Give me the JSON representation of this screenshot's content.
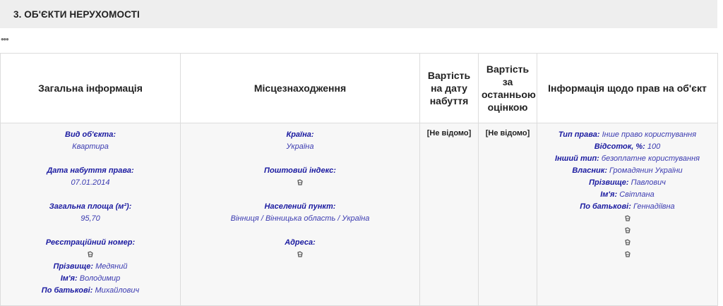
{
  "section": {
    "title": "3.   ОБ'ЄКТИ НЕРУХОМОСТІ"
  },
  "more": "•••",
  "headers": {
    "general": "Загальна інформація",
    "location": "Місцезнаходження",
    "cost_acq": "Вартість на дату набуття",
    "cost_eval": "Вартість за останньою оцінкою",
    "rights": "Інформація щодо прав на об'єкт"
  },
  "general": {
    "type_label": "Вид об'єкта:",
    "type_value": "Квартира",
    "date_label": "Дата набуття права:",
    "date_value": "07.01.2014",
    "area_label": "Загальна площа (м²):",
    "area_value": "95,70",
    "reg_label": "Реєстраційний номер:",
    "surname_label": "Прізвище:",
    "surname_value": "Медяний",
    "name_label": "Ім'я:",
    "name_value": "Володимир",
    "patronymic_label": "По батькові:",
    "patronymic_value": "Михайлович"
  },
  "location": {
    "country_label": "Країна:",
    "country_value": "Україна",
    "postal_label": "Поштовий індекс:",
    "settlement_label": "Населений пункт:",
    "settlement_value": "Вінниця / Вінницька область / Україна",
    "address_label": "Адреса:"
  },
  "cost_acq_value": "[Не відомо]",
  "cost_eval_value": "[Не відомо]",
  "rights": {
    "right_type_label": "Тип права:",
    "right_type_value": "Інше право користування",
    "percent_label": "Відсоток, %:",
    "percent_value": "100",
    "other_type_label": "Інший тип:",
    "other_type_value": "безоплатне користування",
    "owner_label": "Власник:",
    "owner_value": "Громадянин України",
    "surname_label": "Прізвище:",
    "surname_value": "Павлович",
    "name_label": "Ім'я:",
    "name_value": "Світлана",
    "patronymic_label": "По батькові:",
    "patronymic_value": "Геннадіївна"
  },
  "icons": {
    "hidden": "hidden-data-icon"
  }
}
